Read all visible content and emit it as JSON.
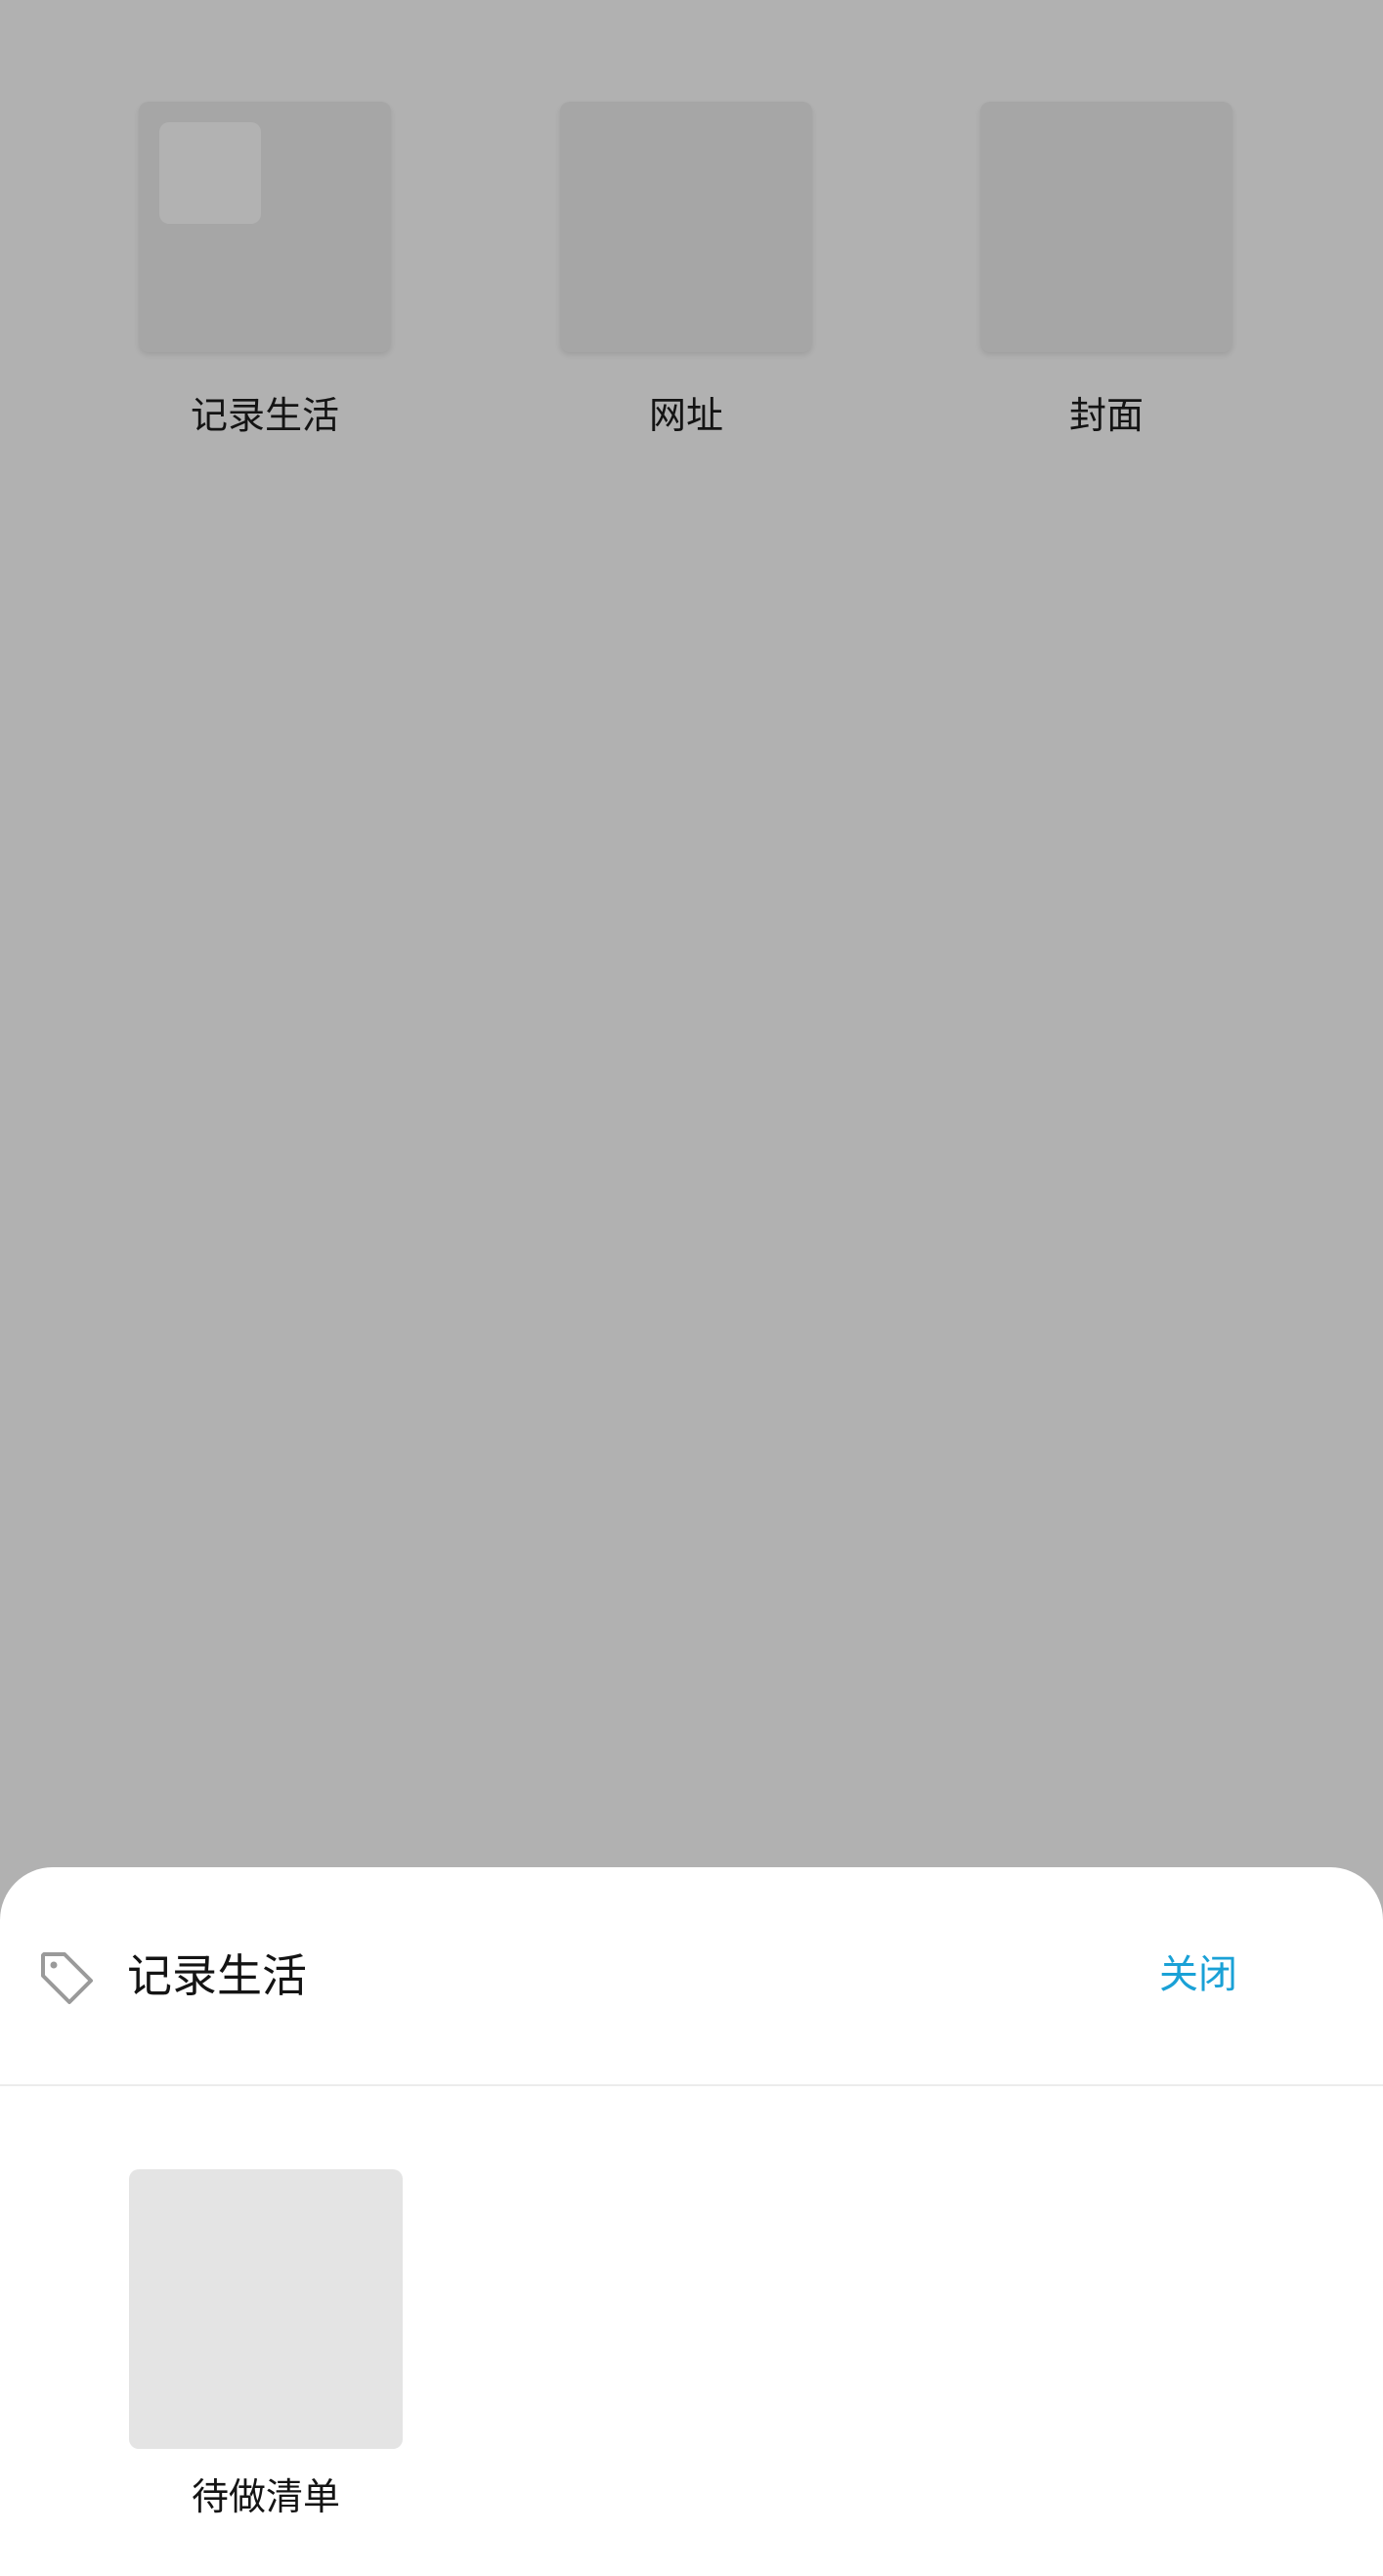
{
  "background_folders": [
    {
      "label": "记录生活",
      "has_thumbnail": true
    },
    {
      "label": "网址",
      "has_thumbnail": false
    },
    {
      "label": "封面",
      "has_thumbnail": false
    }
  ],
  "sheet": {
    "icon": "tag-icon",
    "title": "记录生活",
    "close_label": "关闭",
    "items": [
      {
        "label": "待做清单"
      }
    ]
  },
  "colors": {
    "overlay": "#b1b1b1",
    "accent": "#1aa1d6",
    "sheet_background": "#ffffff",
    "tile_placeholder": "#e4e4e4"
  }
}
